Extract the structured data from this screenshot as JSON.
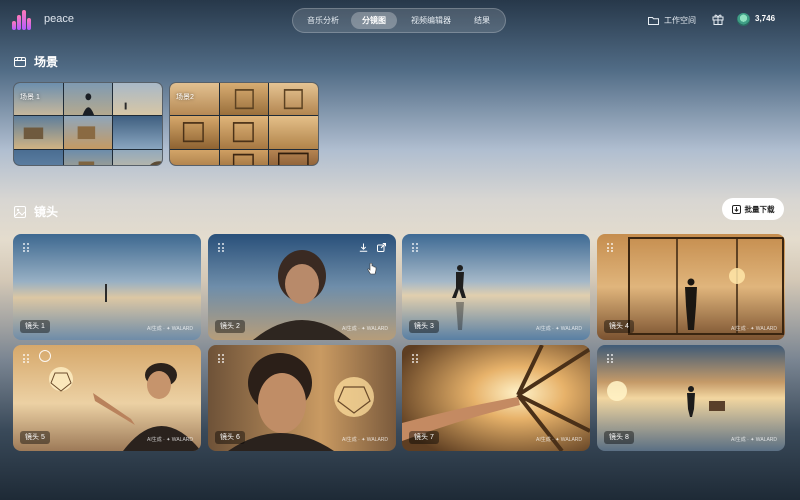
{
  "app": {
    "name": "peace"
  },
  "nav": {
    "tabs": [
      {
        "label": "音乐分析"
      },
      {
        "label": "分镜图"
      },
      {
        "label": "视频编辑器"
      },
      {
        "label": "结果"
      }
    ],
    "active_index": 1
  },
  "header": {
    "workspace_label": "工作空间",
    "credits": "3,746"
  },
  "scenes": {
    "title": "场景",
    "items": [
      {
        "label": "场景 1"
      },
      {
        "label": "场景2"
      }
    ]
  },
  "shots": {
    "title": "镜头",
    "batch_download_label": "批量下载",
    "watermark": "AI生成 · ✦ WALARD",
    "items": [
      {
        "label": "镜头 1"
      },
      {
        "label": "镜头 2"
      },
      {
        "label": "镜头 3"
      },
      {
        "label": "镜头 4"
      },
      {
        "label": "镜头 5"
      },
      {
        "label": "镜头 6"
      },
      {
        "label": "镜头 7"
      },
      {
        "label": "镜头 8"
      }
    ]
  },
  "colors": {
    "accent_logo": "#ff7ab8",
    "button_bg": "#ffffff",
    "tab_active_bg": "rgba(255,255,255,0.28)"
  },
  "icons": [
    "logo-icon",
    "workspace-icon",
    "gift-icon",
    "avatar",
    "scene-section-icon",
    "shot-section-icon",
    "batch-download-icon",
    "drag-handle-icon",
    "download-icon",
    "share-icon",
    "pointer-cursor-icon"
  ]
}
